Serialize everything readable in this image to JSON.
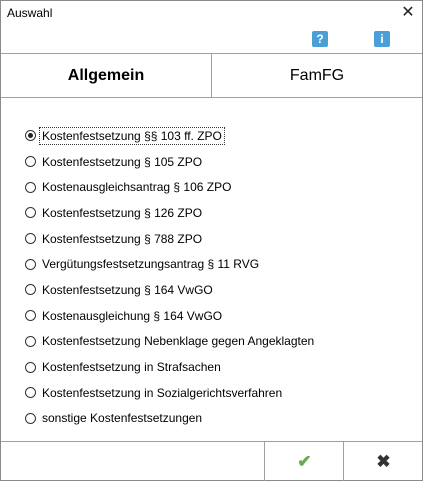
{
  "window": {
    "title": "Auswahl",
    "close_glyph": "✕"
  },
  "toolbar": {
    "help_glyph": "?",
    "info_glyph": "i",
    "help_icon": "help-icon",
    "info_icon": "info-icon"
  },
  "tabs": [
    {
      "label": "Allgemein",
      "active": true
    },
    {
      "label": "FamFG",
      "active": false
    }
  ],
  "options": [
    {
      "label": "Kostenfestsetzung §§ 103 ff. ZPO",
      "selected": true
    },
    {
      "label": "Kostenfestsetzung § 105 ZPO",
      "selected": false
    },
    {
      "label": "Kostenausgleichsantrag § 106 ZPO",
      "selected": false
    },
    {
      "label": "Kostenfestsetzung § 126 ZPO",
      "selected": false
    },
    {
      "label": "Kostenfestsetzung § 788 ZPO",
      "selected": false
    },
    {
      "label": "Vergütungsfestsetzungsantrag § 11 RVG",
      "selected": false
    },
    {
      "label": "Kostenfestsetzung § 164 VwGO",
      "selected": false
    },
    {
      "label": "Kostenausgleichung § 164 VwGO",
      "selected": false
    },
    {
      "label": "Kostenfestsetzung Nebenklage gegen Angeklagten",
      "selected": false
    },
    {
      "label": "Kostenfestsetzung in Strafsachen",
      "selected": false
    },
    {
      "label": "Kostenfestsetzung in Sozialgerichtsverfahren",
      "selected": false
    },
    {
      "label": "sonstige Kostenfestsetzungen",
      "selected": false
    }
  ],
  "footer": {
    "ok_glyph": "✔",
    "cancel_glyph": "✖",
    "ok_color": "#6aa84f"
  }
}
